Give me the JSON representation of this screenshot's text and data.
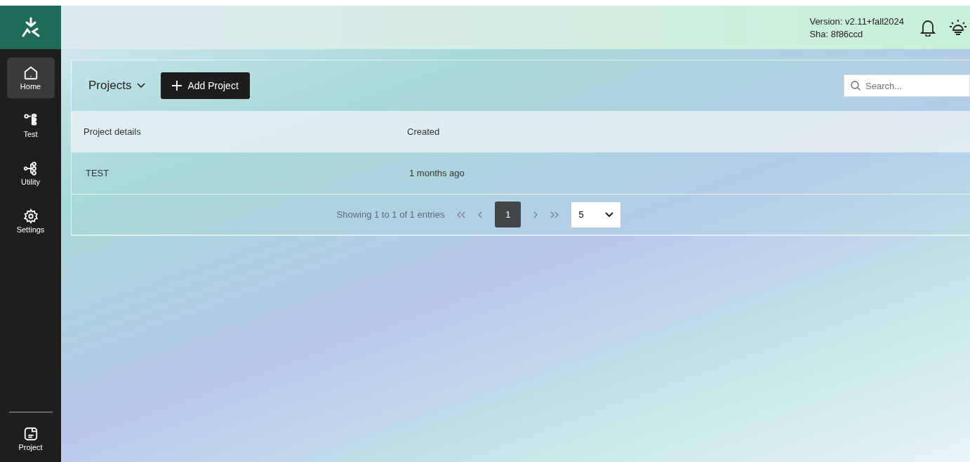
{
  "nav": [
    {
      "label": "Home",
      "selected": true
    },
    {
      "label": "Test",
      "selected": false
    },
    {
      "label": "Utility",
      "selected": false
    },
    {
      "label": "Settings",
      "selected": false
    }
  ],
  "nav_bottom": {
    "label": "Project"
  },
  "header": {
    "version": "Version: v2.11+fall2024",
    "sha": "Sha: 8f86ccd"
  },
  "toolbar": {
    "title": "Projects",
    "add_button": "Add Project",
    "search": {
      "placeholder": "Search..."
    }
  },
  "table": {
    "columns": [
      "Project details",
      "Created"
    ],
    "rows": [
      [
        "TEST",
        "1 months ago"
      ]
    ]
  },
  "pagination": {
    "summary": "Showing 1 to 1 of 1 entries",
    "pages": [
      {
        "label": "1",
        "selected": true
      }
    ],
    "page_size": "5"
  }
}
